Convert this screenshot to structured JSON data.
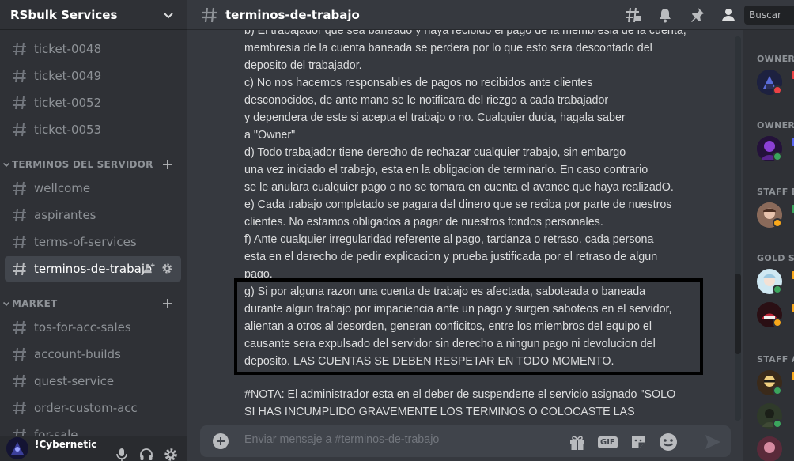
{
  "server": {
    "name": "RSbulk Services"
  },
  "sidebar": {
    "channels_top": [
      "ticket-0048",
      "ticket-0049",
      "ticket-0052",
      "ticket-0053"
    ],
    "categories": [
      {
        "name": "TERMINOS DEL SERVIDOR",
        "channels": [
          "wellcome",
          "aspirantes",
          "terms-of-services",
          "terminos-de-trabajo"
        ]
      },
      {
        "name": "MARKET",
        "channels": [
          "tos-for-acc-sales",
          "account-builds",
          "quest-service",
          "order-custom-acc",
          "for-sale"
        ]
      }
    ],
    "active_channel": "terminos-de-trabajo"
  },
  "user": {
    "name": "!Cybernetic"
  },
  "header": {
    "channel": "terminos-de-trabajo",
    "search_placeholder": "Buscar",
    "icons": [
      "threads-icon",
      "bell-icon",
      "pin-icon",
      "members-icon"
    ]
  },
  "messages": {
    "lines": [
      "b) El trabajador que sea baneado y haya recibido el pago de la membresia de la cuenta,",
      "membresia de la cuenta baneada se perdera por lo que esto sera descontado del",
      "deposito del trabajador.",
      "c) No nos hacemos responsables de pagos no recibidos ante clientes",
      "desconocidos, de ante mano se le notificara del riezgo a cada trabajador",
      "y dependera de este si acepta el trabajo o no. Cualquier duda, hagala saber",
      "a \"Owner\"",
      "d) Todo trabajador tiene derecho de rechazar cualquier trabajo, sin embargo",
      "una vez iniciado el trabajo, esta en la obligacion de terminarlo. En caso contrario",
      "se le anulara cualquier pago o no se tomara en cuenta el avance que haya realizadO.",
      "e)  Cada trabajo completado se pagara del dinero que se reciba por parte de nuestros",
      "clientes. No estamos obligados a pagar de nuestros fondos personales.",
      "f) Ante cualquier irregularidad referente al pago, tardanza o retraso. cada persona",
      "esta en el derecho de pedir explicacion y prueba justificada por el retraso de algun",
      "pago.",
      "g) Si por alguna razon una cuenta de trabajo es afectada, saboteada o baneada",
      "durante algun trabajo por impaciencia ante un pago y surgen saboteos en el servidor,",
      "alientan a otros al desorden, generan conficitos, entre los miembros del equipo  el",
      "causante sera expulsado del servidor sin derecho a ningun pago ni devolucion del",
      "deposito. LAS CUENTAS SE DEBEN RESPETAR EN TODO MOMENTO."
    ],
    "nota_lines": [
      "#NOTA: El administrador esta en el deber de suspenderte el servicio asignado \"SOLO",
      "SI HAS INCUMPLIDO GRAVEMENTE LOS TERMINOS O COLOCASTE LAS"
    ]
  },
  "composer": {
    "placeholder": "Enviar mensaje a #terminos-de-trabajo",
    "gif_label": "GIF"
  },
  "members": {
    "roles": [
      "OWNER",
      "OWNER",
      "STAFF E",
      "GOLD S",
      "STAFF A"
    ]
  },
  "colors": {
    "accent": "#5865f2",
    "online": "#3ba55d",
    "idle": "#faa81a",
    "dnd": "#ed4245",
    "background": "#36393f",
    "sidebar": "#2f3136"
  }
}
